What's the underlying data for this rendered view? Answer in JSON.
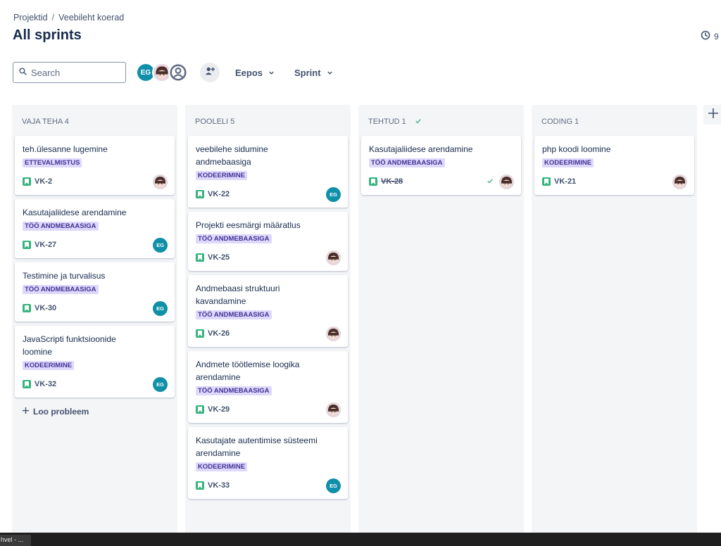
{
  "breadcrumb": {
    "items": [
      "Projektid",
      "Veebileht koerad"
    ],
    "separator": "/"
  },
  "page_title": "All sprints",
  "timer": {
    "icon": "clock-icon",
    "value": "9"
  },
  "toolbar": {
    "search_placeholder": "Search",
    "avatars": [
      {
        "initials": "EG",
        "kind": "initials"
      },
      {
        "initials": "",
        "kind": "photo"
      },
      {
        "initials": "",
        "kind": "default-user"
      }
    ],
    "filters": [
      {
        "label": "Eepos"
      },
      {
        "label": "Sprint"
      }
    ]
  },
  "columns": [
    {
      "title": "VAJA TEHA 4",
      "done_marker": false,
      "cards": [
        {
          "title": "teh.ülesanne lugemine",
          "label": "ETTEVALMISTUS",
          "key": "VK-2",
          "assignee": "photo",
          "done": false
        },
        {
          "title": "Kasutajaliidese arendamine",
          "label": "TÖÖ ANDMEBAASIGA",
          "key": "VK-27",
          "assignee": "EG",
          "done": false
        },
        {
          "title": "Testimine ja turvalisus",
          "label": "TÖÖ ANDMEBAASIGA",
          "key": "VK-30",
          "assignee": "EG",
          "done": false
        },
        {
          "title": "JavaScripti funktsioonide loomine",
          "label": "KODEERIMINE",
          "key": "VK-32",
          "assignee": "EG",
          "done": false
        }
      ],
      "create_label": "Loo probleem"
    },
    {
      "title": "POOLELI 5",
      "done_marker": false,
      "cards": [
        {
          "title": "veebilehe sidumine andmebaasiga",
          "label": "KODEERIMINE",
          "key": "VK-22",
          "assignee": "EG",
          "done": false
        },
        {
          "title": "Projekti eesmärgi määratlus",
          "label": "TÖÖ ANDMEBAASIGA",
          "key": "VK-25",
          "assignee": "photo",
          "done": false
        },
        {
          "title": "Andmebaasi struktuuri kavandamine",
          "label": "TÖÖ ANDMEBAASIGA",
          "key": "VK-26",
          "assignee": "photo",
          "done": false
        },
        {
          "title": "Andmete töötlemise loogika arendamine",
          "label": "TÖÖ ANDMEBAASIGA",
          "key": "VK-29",
          "assignee": "photo",
          "done": false
        },
        {
          "title": "Kasutajate autentimise süsteemi arendamine",
          "label": "KODEERIMINE",
          "key": "VK-33",
          "assignee": "EG",
          "done": false
        }
      ]
    },
    {
      "title": "TEHTUD 1",
      "done_marker": true,
      "cards": [
        {
          "title": "Kasutajaliidese arendamine",
          "label": "TÖÖ ANDMEBAASIGA",
          "key": "VK-28",
          "assignee": "photo",
          "done": true
        }
      ]
    },
    {
      "title": "CODING 1",
      "done_marker": false,
      "cards": [
        {
          "title": "php koodi loomine",
          "label": "KODEERIMINE",
          "key": "VK-21",
          "assignee": "photo",
          "done": false
        }
      ]
    }
  ],
  "taskbar": {
    "item_label": "hvel - ..."
  },
  "colors": {
    "label_bg": "#dfd8fd",
    "label_text": "#403294",
    "story_icon": "#36b37e",
    "avatar_eg": "#0f8fa8",
    "column_bg": "#f4f5f7"
  }
}
